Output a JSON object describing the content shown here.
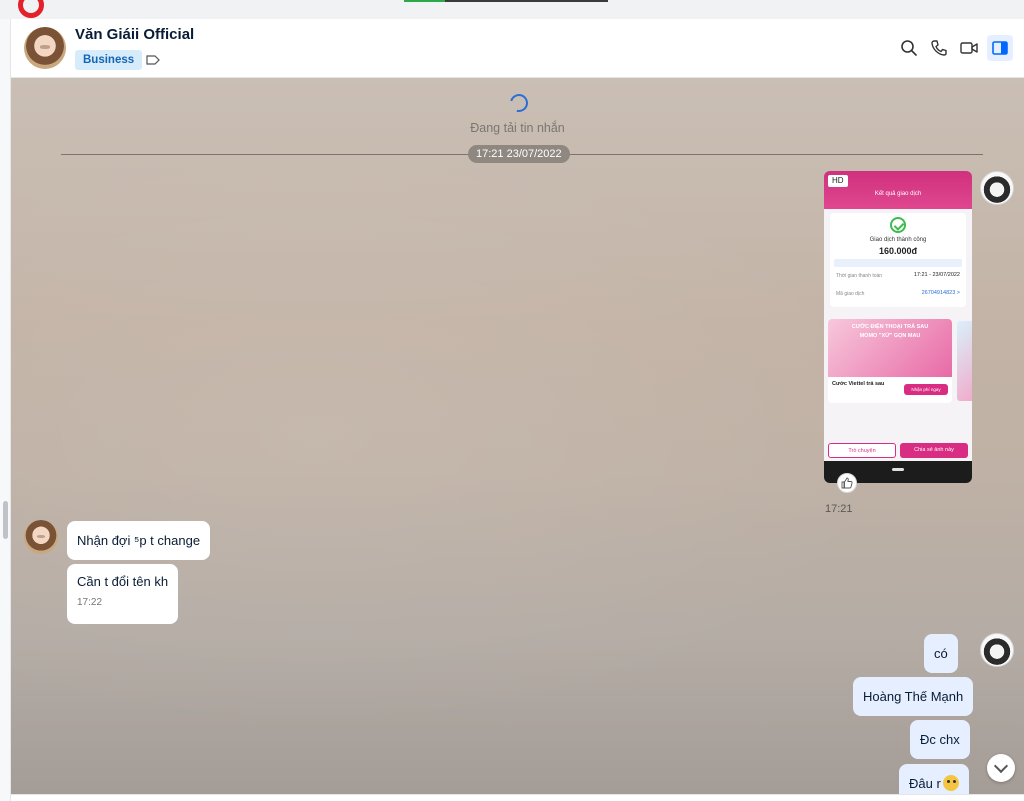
{
  "app": {
    "logo": "zalo-logo",
    "page_load_progress": 0.2
  },
  "header": {
    "contact_name": "Văn Giáii Official",
    "tag": "Business",
    "icons": [
      "search-icon",
      "phone-icon",
      "video-call-icon",
      "toggle-panel-icon"
    ]
  },
  "chat": {
    "loading_text": "Đang tải tin nhắn",
    "date_divider": "17:21 23/07/2022",
    "image_message": {
      "badge": "HD",
      "time": "17:21",
      "screen_title": "Kết quả giao dịch",
      "status": "Giao dịch thành công",
      "amount": "160.000đ",
      "row1_label": "Thời gian thanh toán",
      "row1_value": "17:21 - 23/07/2022",
      "row2_label": "Mã giao dịch",
      "row2_value": "26704914823 >",
      "promo_line1": "CƯỚC ĐIỆN THOẠI TRẢ SAU",
      "promo_line2": "MOMO \"XỬ\" GỌN MAU",
      "promo_title": "Cước Viettel trả sau",
      "promo_button": "Nhận phí ngay",
      "button_chat": "Trò chuyện",
      "button_share": "Chia sẻ ảnh này"
    },
    "incoming": [
      {
        "text": "Nhận đợi ⁵p t change"
      },
      {
        "text": "Cần t đổi tên kh",
        "time": "17:22"
      }
    ],
    "outgoing": [
      {
        "text": "có"
      },
      {
        "text": "Hoàng Thế Mạnh"
      },
      {
        "text": "Đc chx"
      },
      {
        "text": "Đâu r"
      }
    ]
  }
}
